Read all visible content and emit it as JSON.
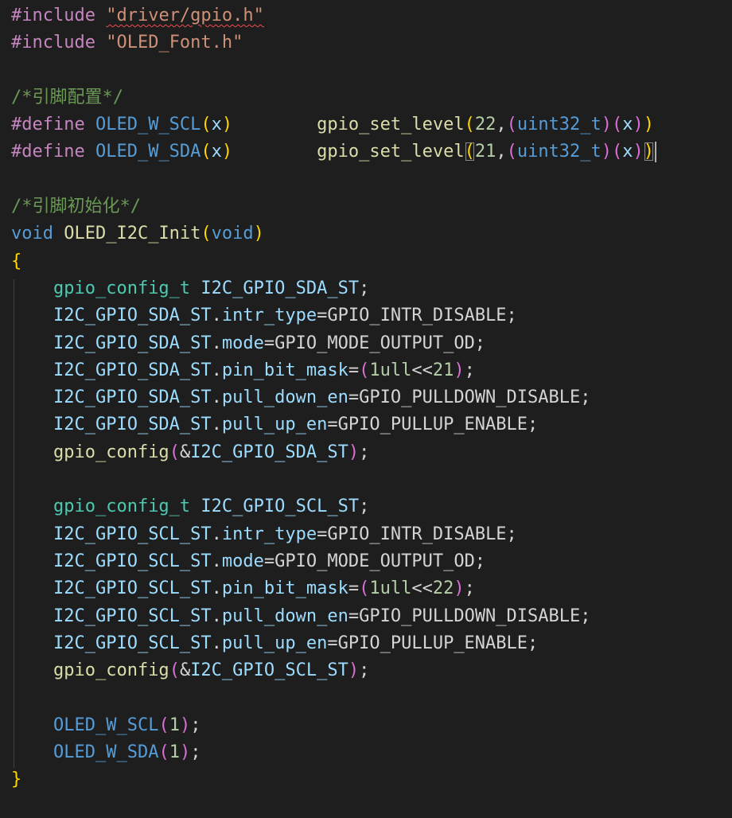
{
  "colors": {
    "background": "#1e1e1e",
    "preprocessor": "#c586c0",
    "string": "#ce9178",
    "comment": "#6a9955",
    "macro": "#569cd6",
    "keyword": "#569cd6",
    "function": "#dcdcaa",
    "type": "#4ec9b0",
    "variable": "#9cdcfe",
    "number": "#b5cea8",
    "plain": "#d4d4d4",
    "bracket_gold": "#ffd700",
    "bracket_pink": "#da70d6",
    "bracket_blue": "#179fff",
    "error_squiggle": "#f14c4c",
    "indent_guide": "#404040"
  },
  "lines": [
    [
      {
        "t": "#include",
        "c": "preprocessor"
      },
      {
        "t": " ",
        "c": "plain"
      },
      {
        "t": "\"driver/gpio.h\"",
        "c": "string",
        "squiggle": true
      }
    ],
    [
      {
        "t": "#include",
        "c": "preprocessor"
      },
      {
        "t": " ",
        "c": "plain"
      },
      {
        "t": "\"OLED_Font.h\"",
        "c": "string"
      }
    ],
    [],
    [
      {
        "t": "/*引脚配置*/",
        "c": "comment"
      }
    ],
    [
      {
        "t": "#define",
        "c": "preprocessor"
      },
      {
        "t": " ",
        "c": "plain"
      },
      {
        "t": "OLED_W_SCL",
        "c": "macro"
      },
      {
        "t": "(",
        "c": "bracket_gold"
      },
      {
        "t": "x",
        "c": "variable"
      },
      {
        "t": ")",
        "c": "bracket_gold"
      },
      {
        "t": "        ",
        "c": "plain"
      },
      {
        "t": "gpio_set_level",
        "c": "function"
      },
      {
        "t": "(",
        "c": "bracket_gold"
      },
      {
        "t": "22",
        "c": "number"
      },
      {
        "t": ",",
        "c": "plain"
      },
      {
        "t": "(",
        "c": "bracket_pink"
      },
      {
        "t": "uint32_t",
        "c": "keyword"
      },
      {
        "t": ")",
        "c": "bracket_pink"
      },
      {
        "t": "(",
        "c": "bracket_pink"
      },
      {
        "t": "x",
        "c": "variable"
      },
      {
        "t": ")",
        "c": "bracket_pink"
      },
      {
        "t": ")",
        "c": "bracket_gold"
      }
    ],
    [
      {
        "t": "#define",
        "c": "preprocessor"
      },
      {
        "t": " ",
        "c": "plain"
      },
      {
        "t": "OLED_W_SDA",
        "c": "macro"
      },
      {
        "t": "(",
        "c": "bracket_gold"
      },
      {
        "t": "x",
        "c": "variable"
      },
      {
        "t": ")",
        "c": "bracket_gold"
      },
      {
        "t": "        ",
        "c": "plain"
      },
      {
        "t": "gpio_set_level",
        "c": "function"
      },
      {
        "t": "(",
        "c": "bracket_gold",
        "match": true
      },
      {
        "t": "21",
        "c": "number"
      },
      {
        "t": ",",
        "c": "plain"
      },
      {
        "t": "(",
        "c": "bracket_pink"
      },
      {
        "t": "uint32_t",
        "c": "keyword"
      },
      {
        "t": ")",
        "c": "bracket_pink"
      },
      {
        "t": "(",
        "c": "bracket_pink"
      },
      {
        "t": "x",
        "c": "variable"
      },
      {
        "t": ")",
        "c": "bracket_pink"
      },
      {
        "t": ")",
        "c": "bracket_gold",
        "match": true,
        "cursor": true
      }
    ],
    [],
    [
      {
        "t": "/*引脚初始化*/",
        "c": "comment"
      }
    ],
    [
      {
        "t": "void",
        "c": "keyword"
      },
      {
        "t": " ",
        "c": "plain"
      },
      {
        "t": "OLED_I2C_Init",
        "c": "function"
      },
      {
        "t": "(",
        "c": "bracket_gold"
      },
      {
        "t": "void",
        "c": "keyword"
      },
      {
        "t": ")",
        "c": "bracket_gold"
      }
    ],
    [
      {
        "t": "{",
        "c": "bracket_gold"
      }
    ],
    [
      {
        "t": "    ",
        "c": "plain"
      },
      {
        "t": "gpio_config_t",
        "c": "type"
      },
      {
        "t": " ",
        "c": "plain"
      },
      {
        "t": "I2C_GPIO_SDA_ST",
        "c": "variable"
      },
      {
        "t": ";",
        "c": "plain"
      }
    ],
    [
      {
        "t": "    ",
        "c": "plain"
      },
      {
        "t": "I2C_GPIO_SDA_ST",
        "c": "variable"
      },
      {
        "t": ".",
        "c": "plain"
      },
      {
        "t": "intr_type",
        "c": "variable"
      },
      {
        "t": "=GPIO_INTR_DISABLE;",
        "c": "plain"
      }
    ],
    [
      {
        "t": "    ",
        "c": "plain"
      },
      {
        "t": "I2C_GPIO_SDA_ST",
        "c": "variable"
      },
      {
        "t": ".",
        "c": "plain"
      },
      {
        "t": "mode",
        "c": "variable"
      },
      {
        "t": "=GPIO_MODE_OUTPUT_OD;",
        "c": "plain"
      }
    ],
    [
      {
        "t": "    ",
        "c": "plain"
      },
      {
        "t": "I2C_GPIO_SDA_ST",
        "c": "variable"
      },
      {
        "t": ".",
        "c": "plain"
      },
      {
        "t": "pin_bit_mask",
        "c": "variable"
      },
      {
        "t": "=",
        "c": "plain"
      },
      {
        "t": "(",
        "c": "bracket_pink"
      },
      {
        "t": "1ull",
        "c": "number"
      },
      {
        "t": "<<",
        "c": "plain"
      },
      {
        "t": "21",
        "c": "number"
      },
      {
        "t": ")",
        "c": "bracket_pink"
      },
      {
        "t": ";",
        "c": "plain"
      }
    ],
    [
      {
        "t": "    ",
        "c": "plain"
      },
      {
        "t": "I2C_GPIO_SDA_ST",
        "c": "variable"
      },
      {
        "t": ".",
        "c": "plain"
      },
      {
        "t": "pull_down_en",
        "c": "variable"
      },
      {
        "t": "=GPIO_PULLDOWN_DISABLE;",
        "c": "plain"
      }
    ],
    [
      {
        "t": "    ",
        "c": "plain"
      },
      {
        "t": "I2C_GPIO_SDA_ST",
        "c": "variable"
      },
      {
        "t": ".",
        "c": "plain"
      },
      {
        "t": "pull_up_en",
        "c": "variable"
      },
      {
        "t": "=GPIO_PULLUP_ENABLE;",
        "c": "plain"
      }
    ],
    [
      {
        "t": "    ",
        "c": "plain"
      },
      {
        "t": "gpio_config",
        "c": "function"
      },
      {
        "t": "(",
        "c": "bracket_pink"
      },
      {
        "t": "&",
        "c": "plain"
      },
      {
        "t": "I2C_GPIO_SDA_ST",
        "c": "variable"
      },
      {
        "t": ")",
        "c": "bracket_pink"
      },
      {
        "t": ";",
        "c": "plain"
      }
    ],
    [],
    [
      {
        "t": "    ",
        "c": "plain"
      },
      {
        "t": "gpio_config_t",
        "c": "type"
      },
      {
        "t": " ",
        "c": "plain"
      },
      {
        "t": "I2C_GPIO_SCL_ST",
        "c": "variable"
      },
      {
        "t": ";",
        "c": "plain"
      }
    ],
    [
      {
        "t": "    ",
        "c": "plain"
      },
      {
        "t": "I2C_GPIO_SCL_ST",
        "c": "variable"
      },
      {
        "t": ".",
        "c": "plain"
      },
      {
        "t": "intr_type",
        "c": "variable"
      },
      {
        "t": "=GPIO_INTR_DISABLE;",
        "c": "plain"
      }
    ],
    [
      {
        "t": "    ",
        "c": "plain"
      },
      {
        "t": "I2C_GPIO_SCL_ST",
        "c": "variable"
      },
      {
        "t": ".",
        "c": "plain"
      },
      {
        "t": "mode",
        "c": "variable"
      },
      {
        "t": "=GPIO_MODE_OUTPUT_OD;",
        "c": "plain"
      }
    ],
    [
      {
        "t": "    ",
        "c": "plain"
      },
      {
        "t": "I2C_GPIO_SCL_ST",
        "c": "variable"
      },
      {
        "t": ".",
        "c": "plain"
      },
      {
        "t": "pin_bit_mask",
        "c": "variable"
      },
      {
        "t": "=",
        "c": "plain"
      },
      {
        "t": "(",
        "c": "bracket_pink"
      },
      {
        "t": "1ull",
        "c": "number"
      },
      {
        "t": "<<",
        "c": "plain"
      },
      {
        "t": "22",
        "c": "number"
      },
      {
        "t": ")",
        "c": "bracket_pink"
      },
      {
        "t": ";",
        "c": "plain"
      }
    ],
    [
      {
        "t": "    ",
        "c": "plain"
      },
      {
        "t": "I2C_GPIO_SCL_ST",
        "c": "variable"
      },
      {
        "t": ".",
        "c": "plain"
      },
      {
        "t": "pull_down_en",
        "c": "variable"
      },
      {
        "t": "=GPIO_PULLDOWN_DISABLE;",
        "c": "plain"
      }
    ],
    [
      {
        "t": "    ",
        "c": "plain"
      },
      {
        "t": "I2C_GPIO_SCL_ST",
        "c": "variable"
      },
      {
        "t": ".",
        "c": "plain"
      },
      {
        "t": "pull_up_en",
        "c": "variable"
      },
      {
        "t": "=GPIO_PULLUP_ENABLE;",
        "c": "plain"
      }
    ],
    [
      {
        "t": "    ",
        "c": "plain"
      },
      {
        "t": "gpio_config",
        "c": "function"
      },
      {
        "t": "(",
        "c": "bracket_pink"
      },
      {
        "t": "&",
        "c": "plain"
      },
      {
        "t": "I2C_GPIO_SCL_ST",
        "c": "variable"
      },
      {
        "t": ")",
        "c": "bracket_pink"
      },
      {
        "t": ";",
        "c": "plain"
      }
    ],
    [],
    [
      {
        "t": "    ",
        "c": "plain"
      },
      {
        "t": "OLED_W_SCL",
        "c": "macro"
      },
      {
        "t": "(",
        "c": "bracket_pink"
      },
      {
        "t": "1",
        "c": "number"
      },
      {
        "t": ")",
        "c": "bracket_pink"
      },
      {
        "t": ";",
        "c": "plain"
      }
    ],
    [
      {
        "t": "    ",
        "c": "plain"
      },
      {
        "t": "OLED_W_SDA",
        "c": "macro"
      },
      {
        "t": "(",
        "c": "bracket_pink"
      },
      {
        "t": "1",
        "c": "number"
      },
      {
        "t": ")",
        "c": "bracket_pink"
      },
      {
        "t": ";",
        "c": "plain"
      }
    ],
    [
      {
        "t": "}",
        "c": "bracket_gold"
      }
    ]
  ]
}
